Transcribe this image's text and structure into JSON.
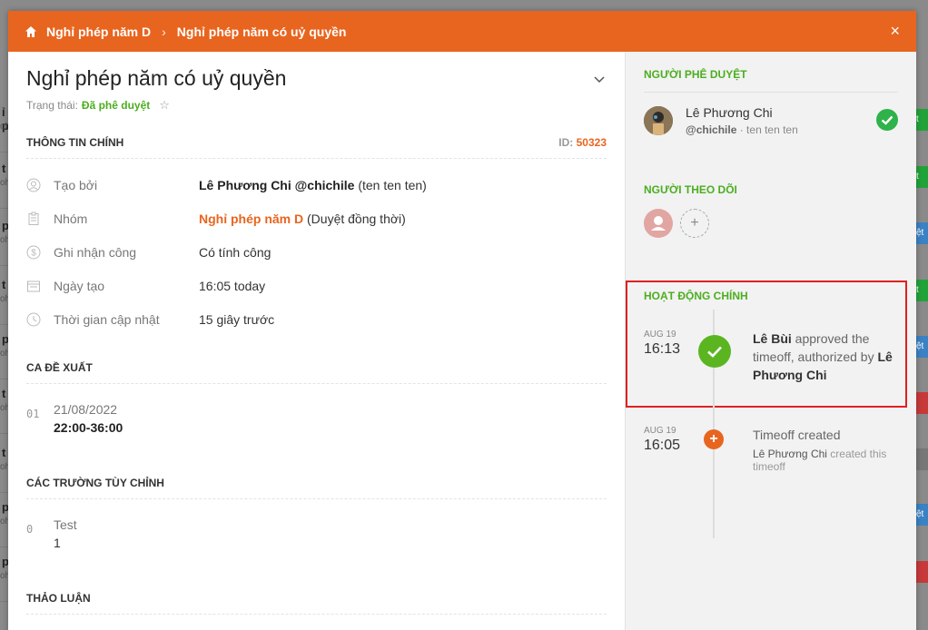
{
  "header": {
    "breadcrumb_parent": "Nghỉ phép năm D",
    "breadcrumb_current": "Nghỉ phép năm có uỷ quyền",
    "close_label": "×"
  },
  "request": {
    "title": "Nghỉ phép năm có uỷ quyền",
    "status_label": "Trạng thái:",
    "status_value": "Đã phê duyệt"
  },
  "main_info": {
    "section_title": "THÔNG TIN CHÍNH",
    "id_label": "ID:",
    "id_value": "50323",
    "rows": [
      {
        "icon": "user-icon",
        "label": "Tạo bởi",
        "value_bold": "Lê Phương Chi @chichile",
        "value_rest": " (ten ten ten)"
      },
      {
        "icon": "clipboard-icon",
        "label": "Nhóm",
        "value_bold": "Nghỉ phép năm D",
        "value_rest": " (Duyệt đồng thời)"
      },
      {
        "icon": "dollar-icon",
        "label": "Ghi nhận công",
        "value_bold": "",
        "value_rest": "Có tính công"
      },
      {
        "icon": "calendar-icon",
        "label": "Ngày tạo",
        "value_bold": "",
        "value_rest": "16:05 today"
      },
      {
        "icon": "clock-icon",
        "label": "Thời gian cập nhật",
        "value_bold": "",
        "value_rest": "15 giây trước"
      }
    ]
  },
  "shifts": {
    "section_title": "CA ĐỀ XUẤT",
    "items": [
      {
        "index": "01",
        "date": "21/08/2022",
        "time": "22:00-36:00"
      }
    ]
  },
  "custom_fields": {
    "section_title": "CÁC TRƯỜNG TÙY CHỈNH",
    "items": [
      {
        "index": "0",
        "name": "Test",
        "value": "1"
      }
    ]
  },
  "discussion": {
    "section_title": "THẢO LUẬN"
  },
  "approvers": {
    "section_title": "NGƯỜI PHÊ DUYỆT",
    "items": [
      {
        "name": "Lê Phương Chi",
        "handle": "@chichile",
        "note": " · ten ten ten",
        "approved": true
      }
    ]
  },
  "followers": {
    "section_title": "NGƯỜI THEO DÕI",
    "add_label": "+"
  },
  "activity": {
    "section_title": "HOẠT ĐỘNG CHÍNH",
    "items": [
      {
        "month": "AUG 19",
        "time": "16:13",
        "actor": "Lê Bùi",
        "text": " approved the timeoff, authorized by ",
        "target": "Lê Phương Chi"
      },
      {
        "month": "AUG 19",
        "time": "16:05",
        "text": "Timeoff created",
        "sub_name": "Lê Phương Chi",
        "sub_text": " created this timeoff"
      }
    ]
  },
  "colors": {
    "header_orange": "#e8651f",
    "approved_green": "#4cae1f",
    "highlight_red": "#e02020"
  }
}
